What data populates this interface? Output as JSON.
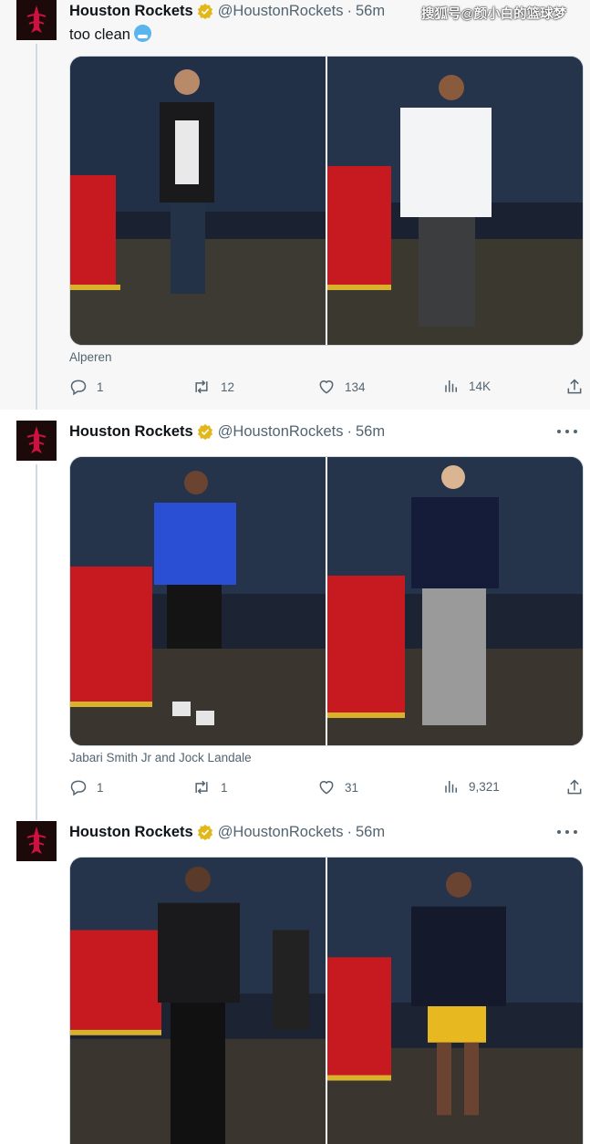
{
  "watermark": "搜狐号@颜小白的篮球梦",
  "account": {
    "name": "Houston Rockets",
    "handle": "@HoustonRockets",
    "separator": "·"
  },
  "tweets": [
    {
      "time": "56m",
      "text": "too clean",
      "caption": "Alperen",
      "stats": {
        "replies": "1",
        "reposts": "12",
        "likes": "134",
        "views": "14K"
      }
    },
    {
      "time": "56m",
      "caption": "Jabari Smith Jr and Jock Landale",
      "stats": {
        "replies": "1",
        "reposts": "1",
        "likes": "31",
        "views": "9,321"
      }
    },
    {
      "time": "56m"
    }
  ],
  "icons": {
    "verified": "gold-verified-badge-icon",
    "reply": "reply-icon",
    "repost": "repost-icon",
    "like": "heart-icon",
    "views": "views-chart-icon",
    "share": "share-icon",
    "more": "more-dots-icon",
    "emoji": "cold-face-emoji"
  },
  "colors": {
    "verified_gold": "#e2b719",
    "secondary_text": "#536471",
    "rockets_red": "#ce1141",
    "thread_line": "#cfd9de"
  }
}
